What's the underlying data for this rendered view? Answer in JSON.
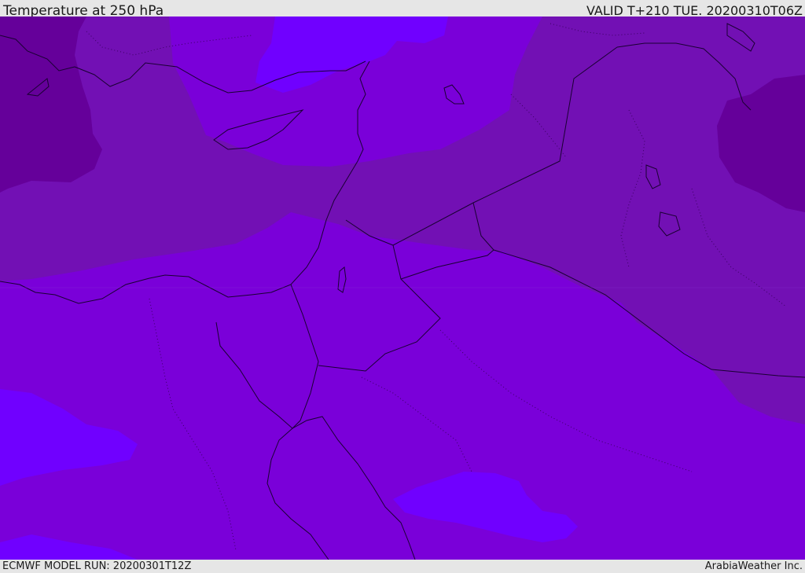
{
  "header": {
    "title": "Temperature at 250 hPa",
    "valid_time": "VALID T+210 TUE. 20200310T06Z"
  },
  "footer": {
    "model_run": "ECMWF MODEL RUN: 20200301T12Z",
    "credit": "ArabiaWeather Inc."
  },
  "map": {
    "field": "temperature",
    "level": "250 hPa",
    "colors": {
      "dominant": "#7a00d9",
      "cold_band": "#7210b4",
      "coldest": "#65009a",
      "warm_patch": "#7000ff",
      "warmer_patch": "#7a22ff",
      "border_line": "#1a0033",
      "country_dots": "#3a0060"
    }
  }
}
